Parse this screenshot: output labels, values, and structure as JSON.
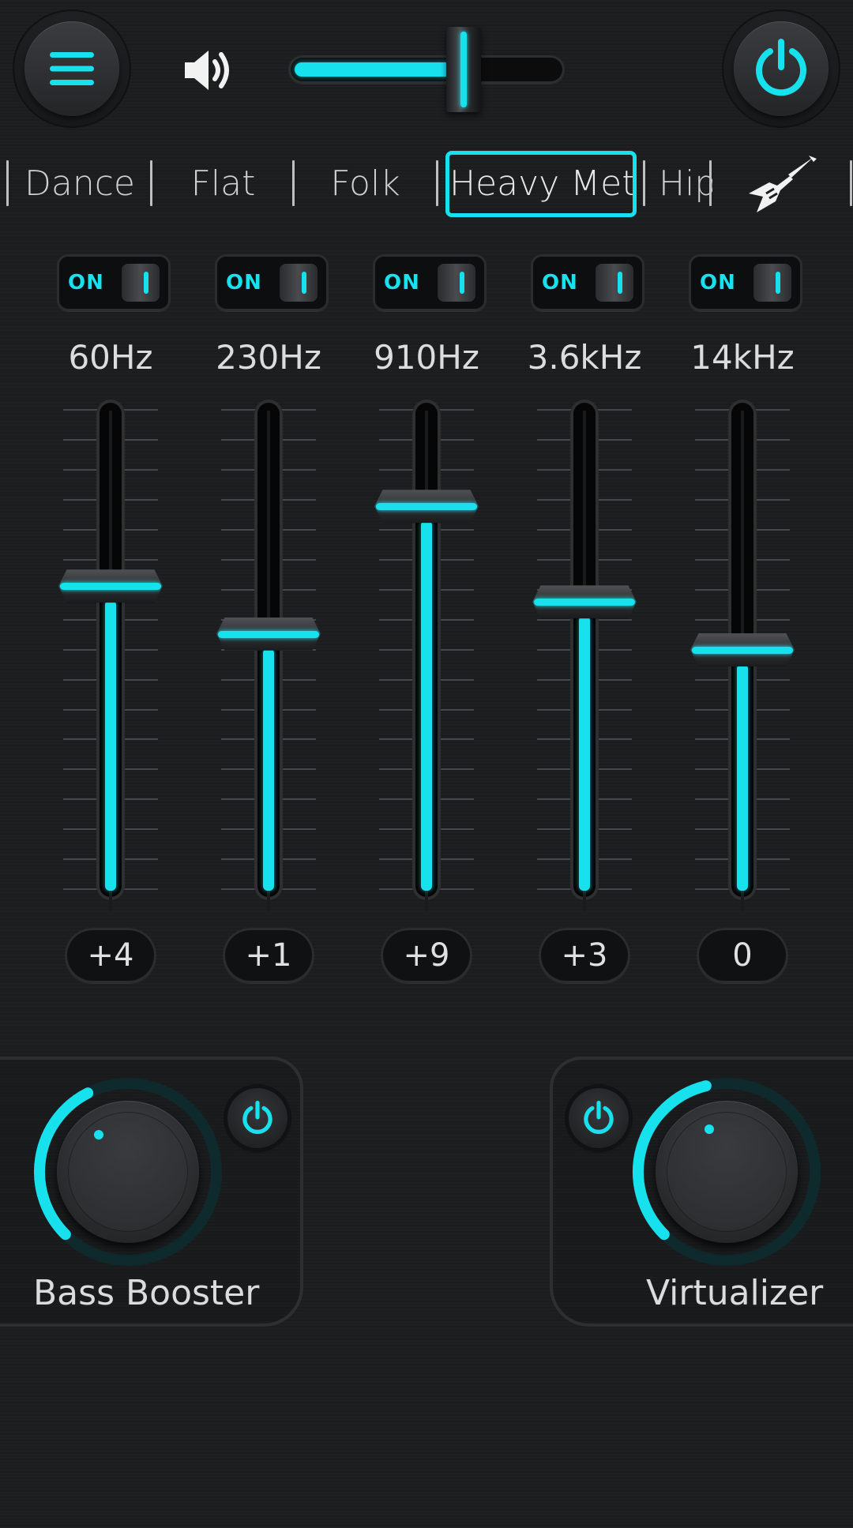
{
  "header": {
    "menu_icon": "hamburger-menu-icon",
    "volume_icon": "speaker-volume-icon",
    "volume_level": 0.64,
    "power_icon": "power-icon"
  },
  "presets": {
    "items": [
      "Dance",
      "Flat",
      "Folk",
      "Heavy Metal",
      "Hip"
    ],
    "selected": "Heavy Metal",
    "custom_icon": "electric-guitar-icon"
  },
  "bands": [
    {
      "toggle": "ON",
      "freq": "60Hz",
      "gain": "+4"
    },
    {
      "toggle": "ON",
      "freq": "230Hz",
      "gain": "+1"
    },
    {
      "toggle": "ON",
      "freq": "910Hz",
      "gain": "+9"
    },
    {
      "toggle": "ON",
      "freq": "3.6kHz",
      "gain": "+3"
    },
    {
      "toggle": "ON",
      "freq": "14kHz",
      "gain": "0"
    }
  ],
  "bass_booster": {
    "label": "Bass Booster",
    "level": 0.4,
    "enabled": true
  },
  "virtualizer": {
    "label": "Virtualizer",
    "level": 0.45,
    "enabled": true
  },
  "colors": {
    "accent": "#18e1ee",
    "background": "#1c1d1f"
  }
}
